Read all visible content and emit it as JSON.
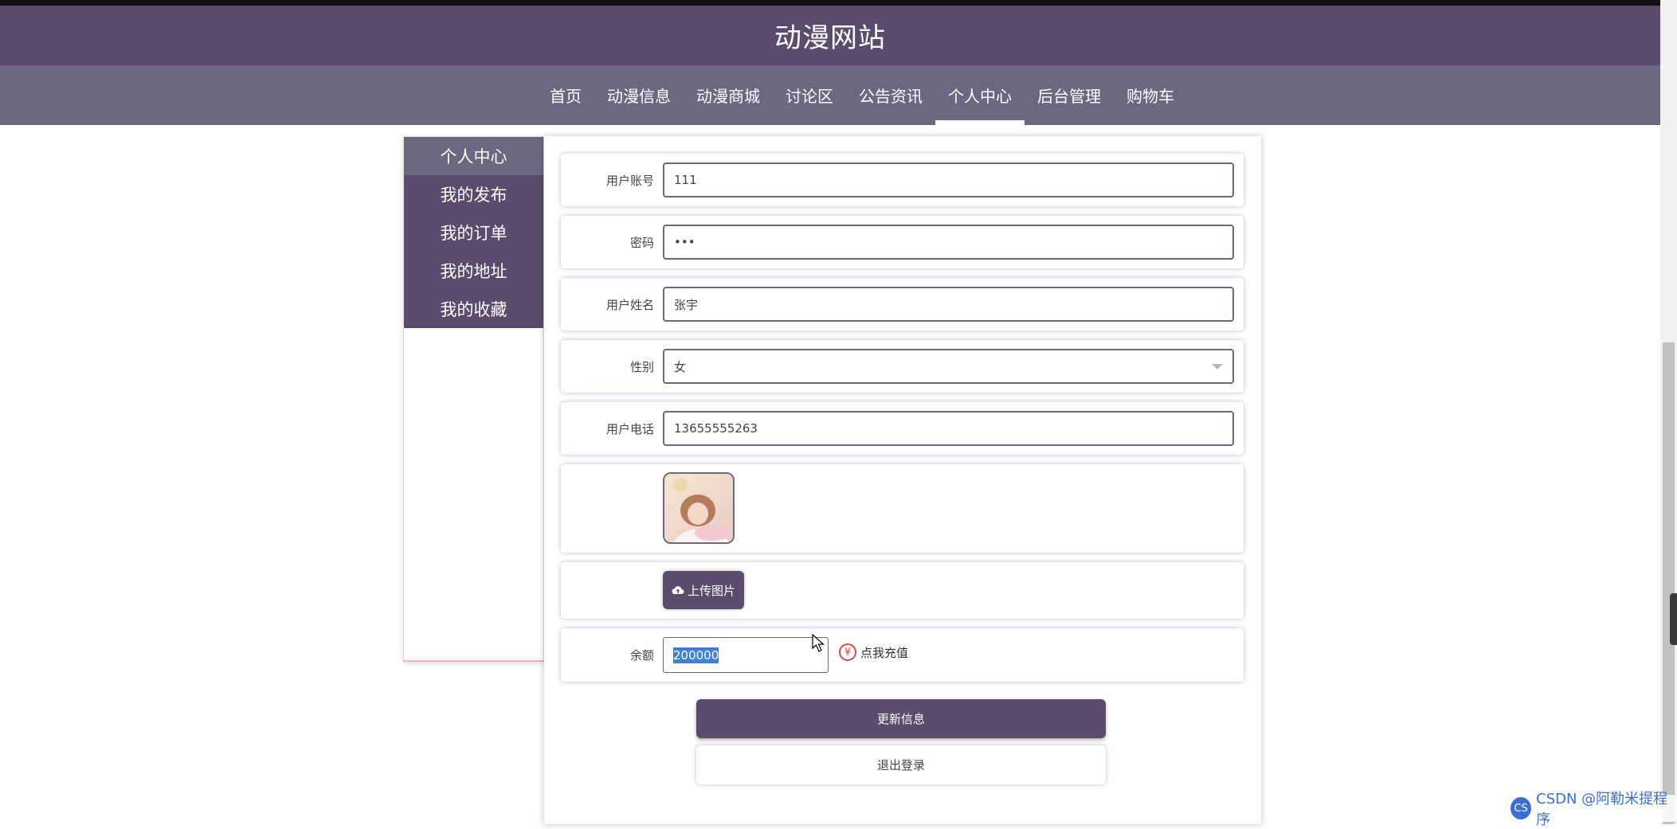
{
  "header": {
    "title": "动漫网站"
  },
  "nav": {
    "items": [
      {
        "label": "首页"
      },
      {
        "label": "动漫信息"
      },
      {
        "label": "动漫商城"
      },
      {
        "label": "讨论区"
      },
      {
        "label": "公告资讯"
      },
      {
        "label": "个人中心",
        "active": true
      },
      {
        "label": "后台管理"
      },
      {
        "label": "购物车"
      }
    ]
  },
  "sidebar": {
    "items": [
      {
        "label": "个人中心",
        "active": true
      },
      {
        "label": "我的发布"
      },
      {
        "label": "我的订单"
      },
      {
        "label": "我的地址"
      },
      {
        "label": "我的收藏"
      }
    ]
  },
  "form": {
    "account": {
      "label": "用户账号",
      "value": "111"
    },
    "password": {
      "label": "密码",
      "value": "•••"
    },
    "name": {
      "label": "用户姓名",
      "value": "张宇"
    },
    "gender": {
      "label": "性别",
      "value": "女"
    },
    "phone": {
      "label": "用户电话",
      "value": "13655555263"
    },
    "upload_label": "上传图片",
    "balance": {
      "label": "余额",
      "value": "200000"
    },
    "recharge_label": "点我充值",
    "recharge_icon": "¥"
  },
  "buttons": {
    "update": "更新信息",
    "logout": "退出登录"
  },
  "watermark": {
    "logo": "CS",
    "text": "CSDN @阿勒米提程序"
  },
  "colors": {
    "primary": "#5b4b6c",
    "nav_bg": "#6d6781",
    "accent_red": "#e04a4a"
  }
}
